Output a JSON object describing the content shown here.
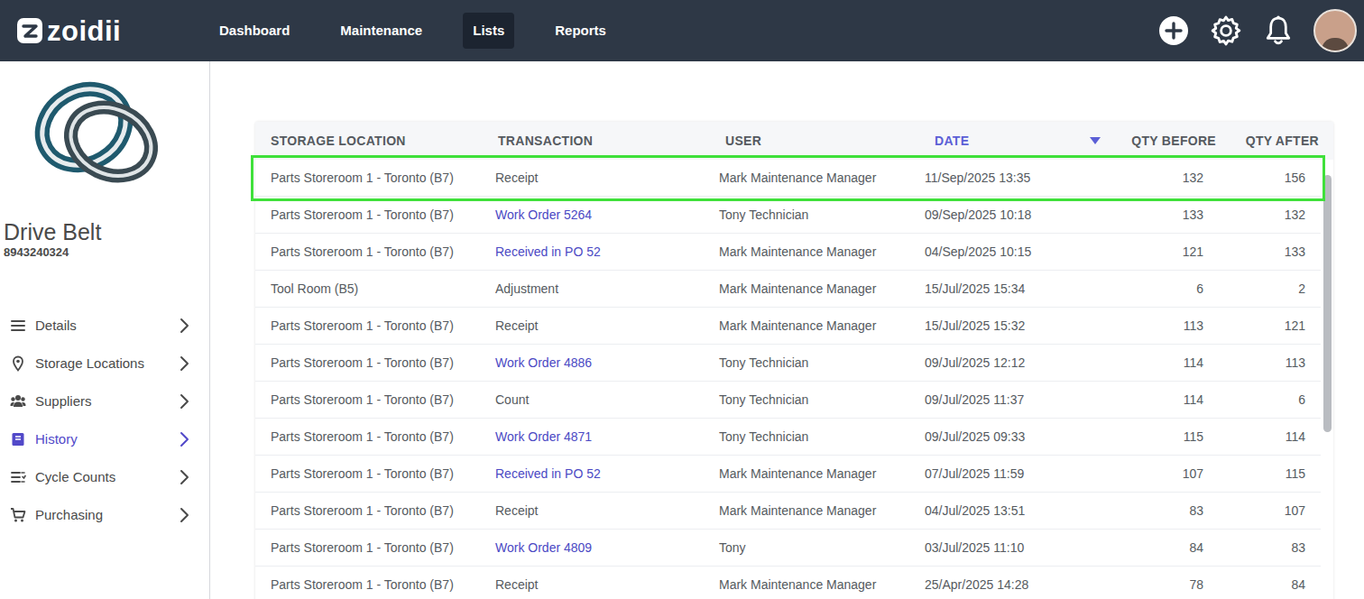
{
  "nav": {
    "logo": "zoidii",
    "items": [
      {
        "label": "Dashboard",
        "selected": false
      },
      {
        "label": "Maintenance",
        "selected": false
      },
      {
        "label": "Lists",
        "selected": true
      },
      {
        "label": "Reports",
        "selected": false
      }
    ]
  },
  "part": {
    "name": "Drive Belt",
    "code": "8943240324"
  },
  "sidebar": {
    "items": [
      {
        "label": "Details",
        "selected": false
      },
      {
        "label": "Storage Locations",
        "selected": false
      },
      {
        "label": "Suppliers",
        "selected": false
      },
      {
        "label": "History",
        "selected": true
      },
      {
        "label": "Cycle Counts",
        "selected": false
      },
      {
        "label": "Purchasing",
        "selected": false
      }
    ]
  },
  "table": {
    "columns": [
      {
        "label": "STORAGE LOCATION",
        "sorted": false
      },
      {
        "label": "TRANSACTION",
        "sorted": false
      },
      {
        "label": "USER",
        "sorted": false
      },
      {
        "label": "DATE",
        "sorted": true
      },
      {
        "label": "QTY BEFORE",
        "sorted": false
      },
      {
        "label": "QTY AFTER",
        "sorted": false
      }
    ],
    "rows": [
      {
        "location": "Parts Storeroom 1 - Toronto (B7)",
        "transaction": "Receipt",
        "link": false,
        "user": "Mark Maintenance Manager",
        "date": "11/Sep/2025 13:35",
        "qty_before": "132",
        "qty_after": "156",
        "highlighted": true
      },
      {
        "location": "Parts Storeroom 1 - Toronto (B7)",
        "transaction": "Work Order 5264",
        "link": true,
        "user": "Tony Technician",
        "date": "09/Sep/2025 10:18",
        "qty_before": "133",
        "qty_after": "132",
        "highlighted": false
      },
      {
        "location": "Parts Storeroom 1 - Toronto (B7)",
        "transaction": "Received in PO 52",
        "link": true,
        "user": "Mark Maintenance Manager",
        "date": "04/Sep/2025 10:15",
        "qty_before": "121",
        "qty_after": "133",
        "highlighted": false
      },
      {
        "location": "Tool Room (B5)",
        "transaction": "Adjustment",
        "link": false,
        "user": "Mark Maintenance Manager",
        "date": "15/Jul/2025 15:34",
        "qty_before": "6",
        "qty_after": "2",
        "highlighted": false
      },
      {
        "location": "Parts Storeroom 1 - Toronto (B7)",
        "transaction": "Receipt",
        "link": false,
        "user": "Mark Maintenance Manager",
        "date": "15/Jul/2025 15:32",
        "qty_before": "113",
        "qty_after": "121",
        "highlighted": false
      },
      {
        "location": "Parts Storeroom 1 - Toronto (B7)",
        "transaction": "Work Order 4886",
        "link": true,
        "user": "Tony Technician",
        "date": "09/Jul/2025 12:12",
        "qty_before": "114",
        "qty_after": "113",
        "highlighted": false
      },
      {
        "location": "Parts Storeroom 1 - Toronto (B7)",
        "transaction": "Count",
        "link": false,
        "user": "Tony Technician",
        "date": "09/Jul/2025 11:37",
        "qty_before": "114",
        "qty_after": "6",
        "highlighted": false
      },
      {
        "location": "Parts Storeroom 1 - Toronto (B7)",
        "transaction": "Work Order 4871",
        "link": true,
        "user": "Tony Technician",
        "date": "09/Jul/2025 09:33",
        "qty_before": "115",
        "qty_after": "114",
        "highlighted": false
      },
      {
        "location": "Parts Storeroom 1 - Toronto (B7)",
        "transaction": "Received in PO 52",
        "link": true,
        "user": "Mark Maintenance Manager",
        "date": "07/Jul/2025 11:59",
        "qty_before": "107",
        "qty_after": "115",
        "highlighted": false
      },
      {
        "location": "Parts Storeroom 1 - Toronto (B7)",
        "transaction": "Receipt",
        "link": false,
        "user": "Mark Maintenance Manager",
        "date": "04/Jul/2025 13:51",
        "qty_before": "83",
        "qty_after": "107",
        "highlighted": false
      },
      {
        "location": "Parts Storeroom 1 - Toronto (B7)",
        "transaction": "Work Order 4809",
        "link": true,
        "user": "Tony",
        "date": "03/Jul/2025 11:10",
        "qty_before": "84",
        "qty_after": "83",
        "highlighted": false
      },
      {
        "location": "Parts Storeroom 1 - Toronto (B7)",
        "transaction": "Receipt",
        "link": false,
        "user": "Mark Maintenance Manager",
        "date": "25/Apr/2025 14:28",
        "qty_before": "78",
        "qty_after": "84",
        "highlighted": false
      }
    ],
    "scrollbar": {
      "level": 0.6
    }
  }
}
